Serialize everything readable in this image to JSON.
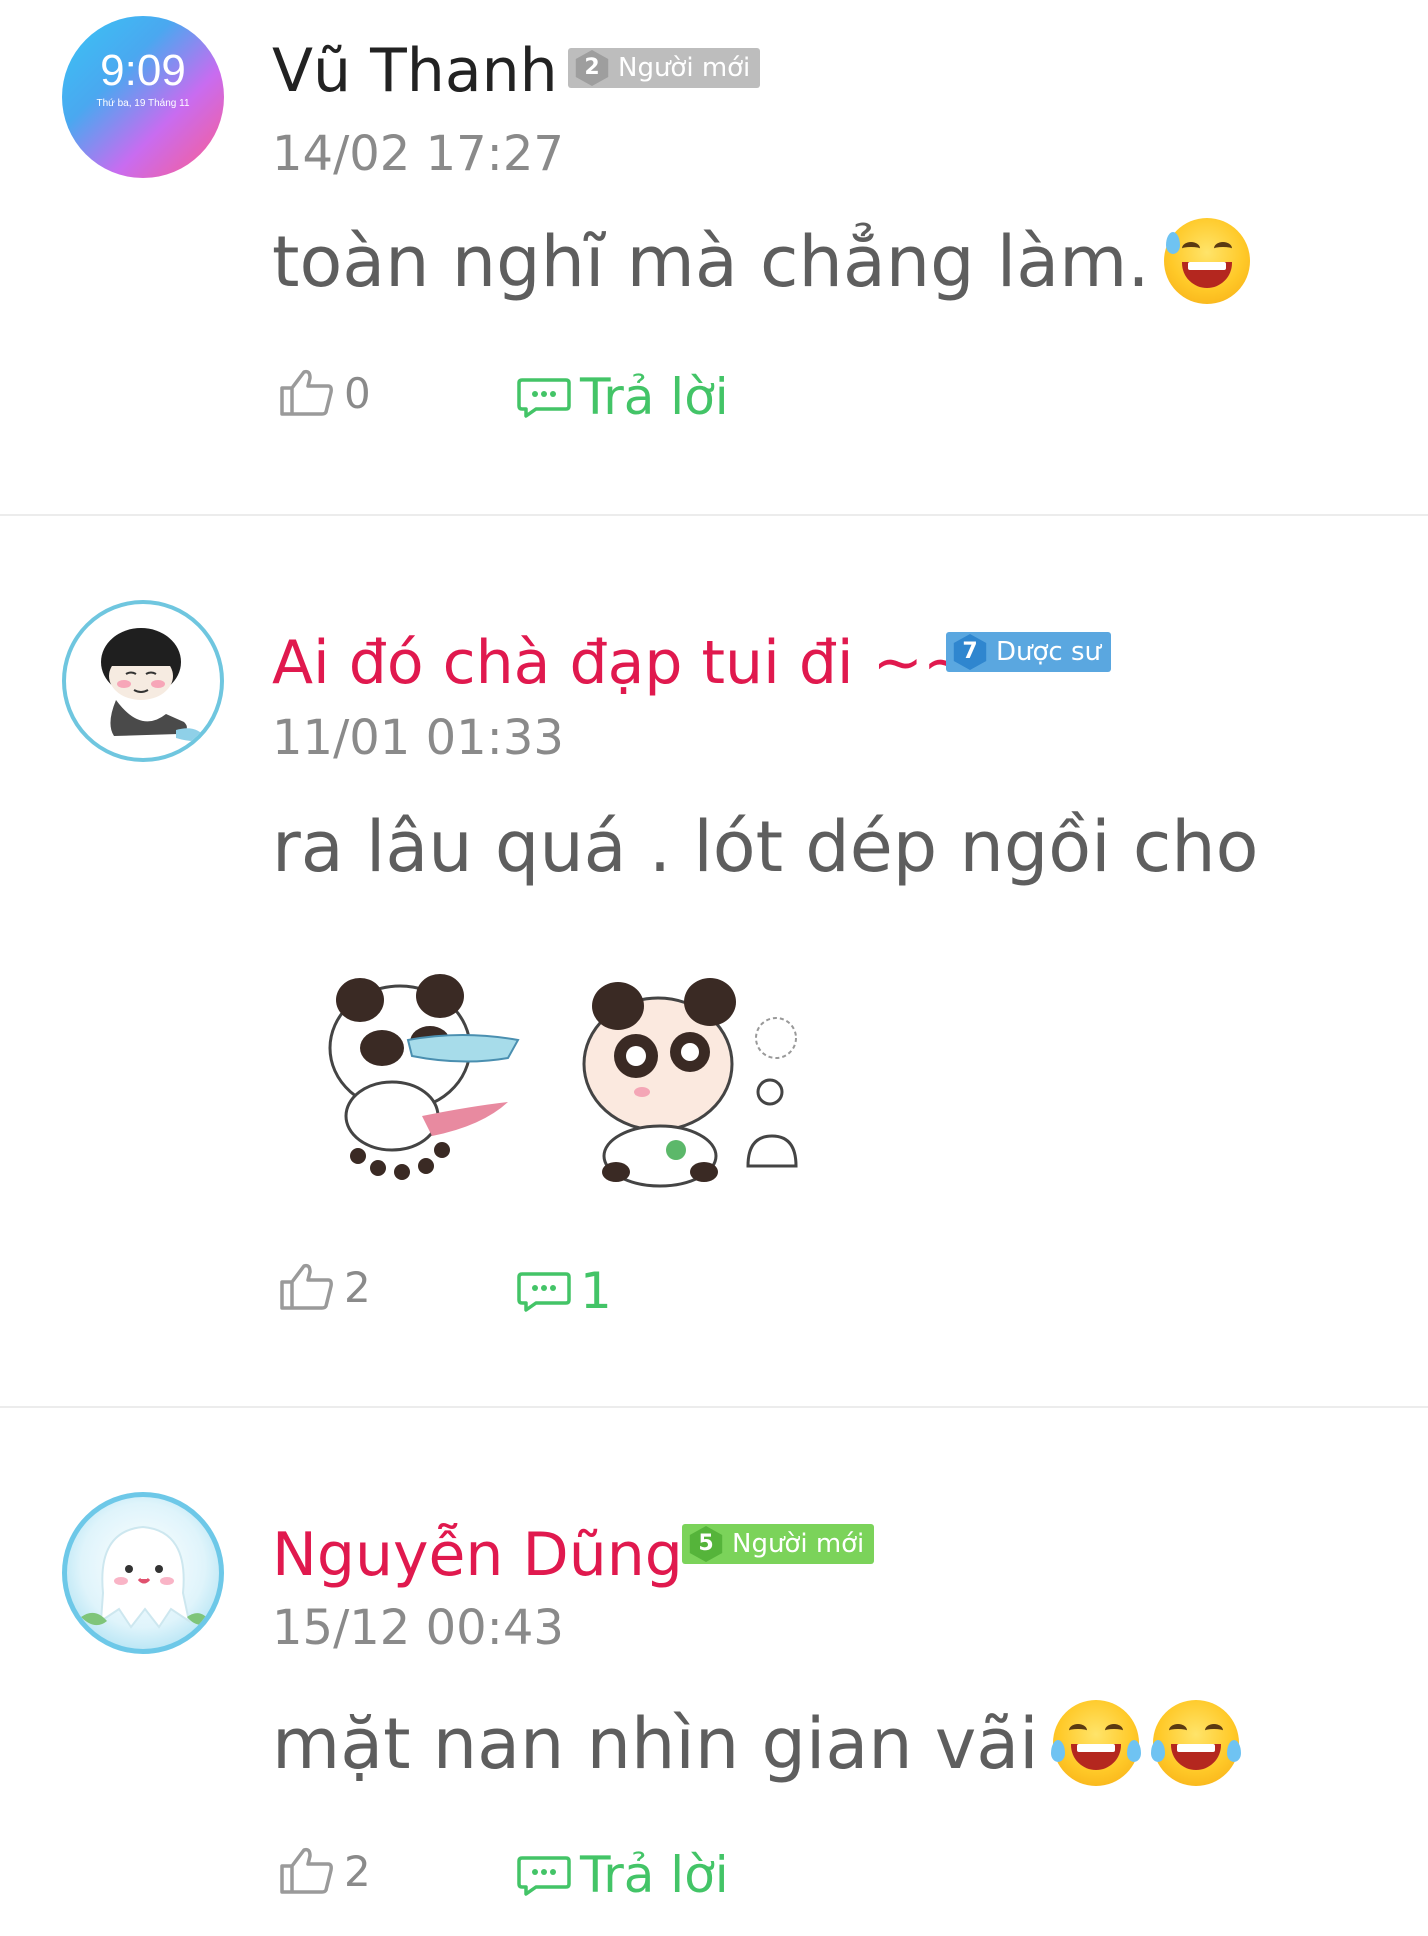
{
  "comments": [
    {
      "name": "Vũ Thanh",
      "name_color": "#222222",
      "badge_level": "2",
      "badge_label": "Người mới",
      "badge_color": "#bdbdbd",
      "time": "14/02 17:27",
      "text": "toàn nghĩ mà chẳng làm.",
      "emoji_count": 1,
      "likes": "0",
      "reply": "Trả lời",
      "avatar": {
        "clock": "9:09",
        "date": "Thứ ba, 19 Tháng 11"
      }
    },
    {
      "name": "Ai đó chà đạp tui đi ~~",
      "name_color": "#e0194e",
      "badge_level": "7",
      "badge_label": "Dược sư",
      "badge_color": "#5aa7e0",
      "time": "11/01 01:33",
      "text": "ra lâu quá . lót dép ngồi cho",
      "likes": "2",
      "reply": "1"
    },
    {
      "name": "Nguyễn Dũng",
      "name_color": "#e0194e",
      "badge_level": "5",
      "badge_label": "Người mới",
      "badge_color": "#7bd35a",
      "time": "15/12 00:43",
      "text": "mặt nan nhìn gian vãi",
      "emoji_count": 2,
      "likes": "2",
      "reply": "Trả lời"
    }
  ],
  "icons": {
    "like": "thumbs-up-icon",
    "reply": "chat-bubble-icon"
  },
  "colors": {
    "reply_green": "#43c467",
    "name_red": "#e0194e",
    "divider": "#ececec"
  }
}
